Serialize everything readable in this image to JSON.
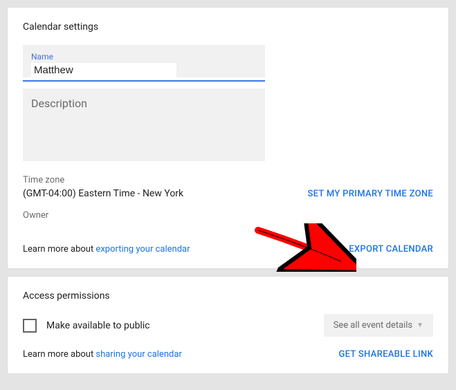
{
  "settings": {
    "title": "Calendar settings",
    "name_label": "Name",
    "name_value": "Matthew",
    "description_placeholder": "Description",
    "timezone_label": "Time zone",
    "timezone_value": "(GMT-04:00) Eastern Time - New York",
    "set_primary_tz": "SET MY PRIMARY TIME ZONE",
    "owner_label": "Owner",
    "learn_prefix": "Learn more about ",
    "export_link_text": "exporting your calendar",
    "export_button": "EXPORT CALENDAR"
  },
  "permissions": {
    "title": "Access permissions",
    "public_label": "Make available to public",
    "details_button": "See all event details",
    "learn_prefix": "Learn more about ",
    "share_link_text": "sharing your calendar",
    "get_link_button": "GET SHAREABLE LINK"
  }
}
